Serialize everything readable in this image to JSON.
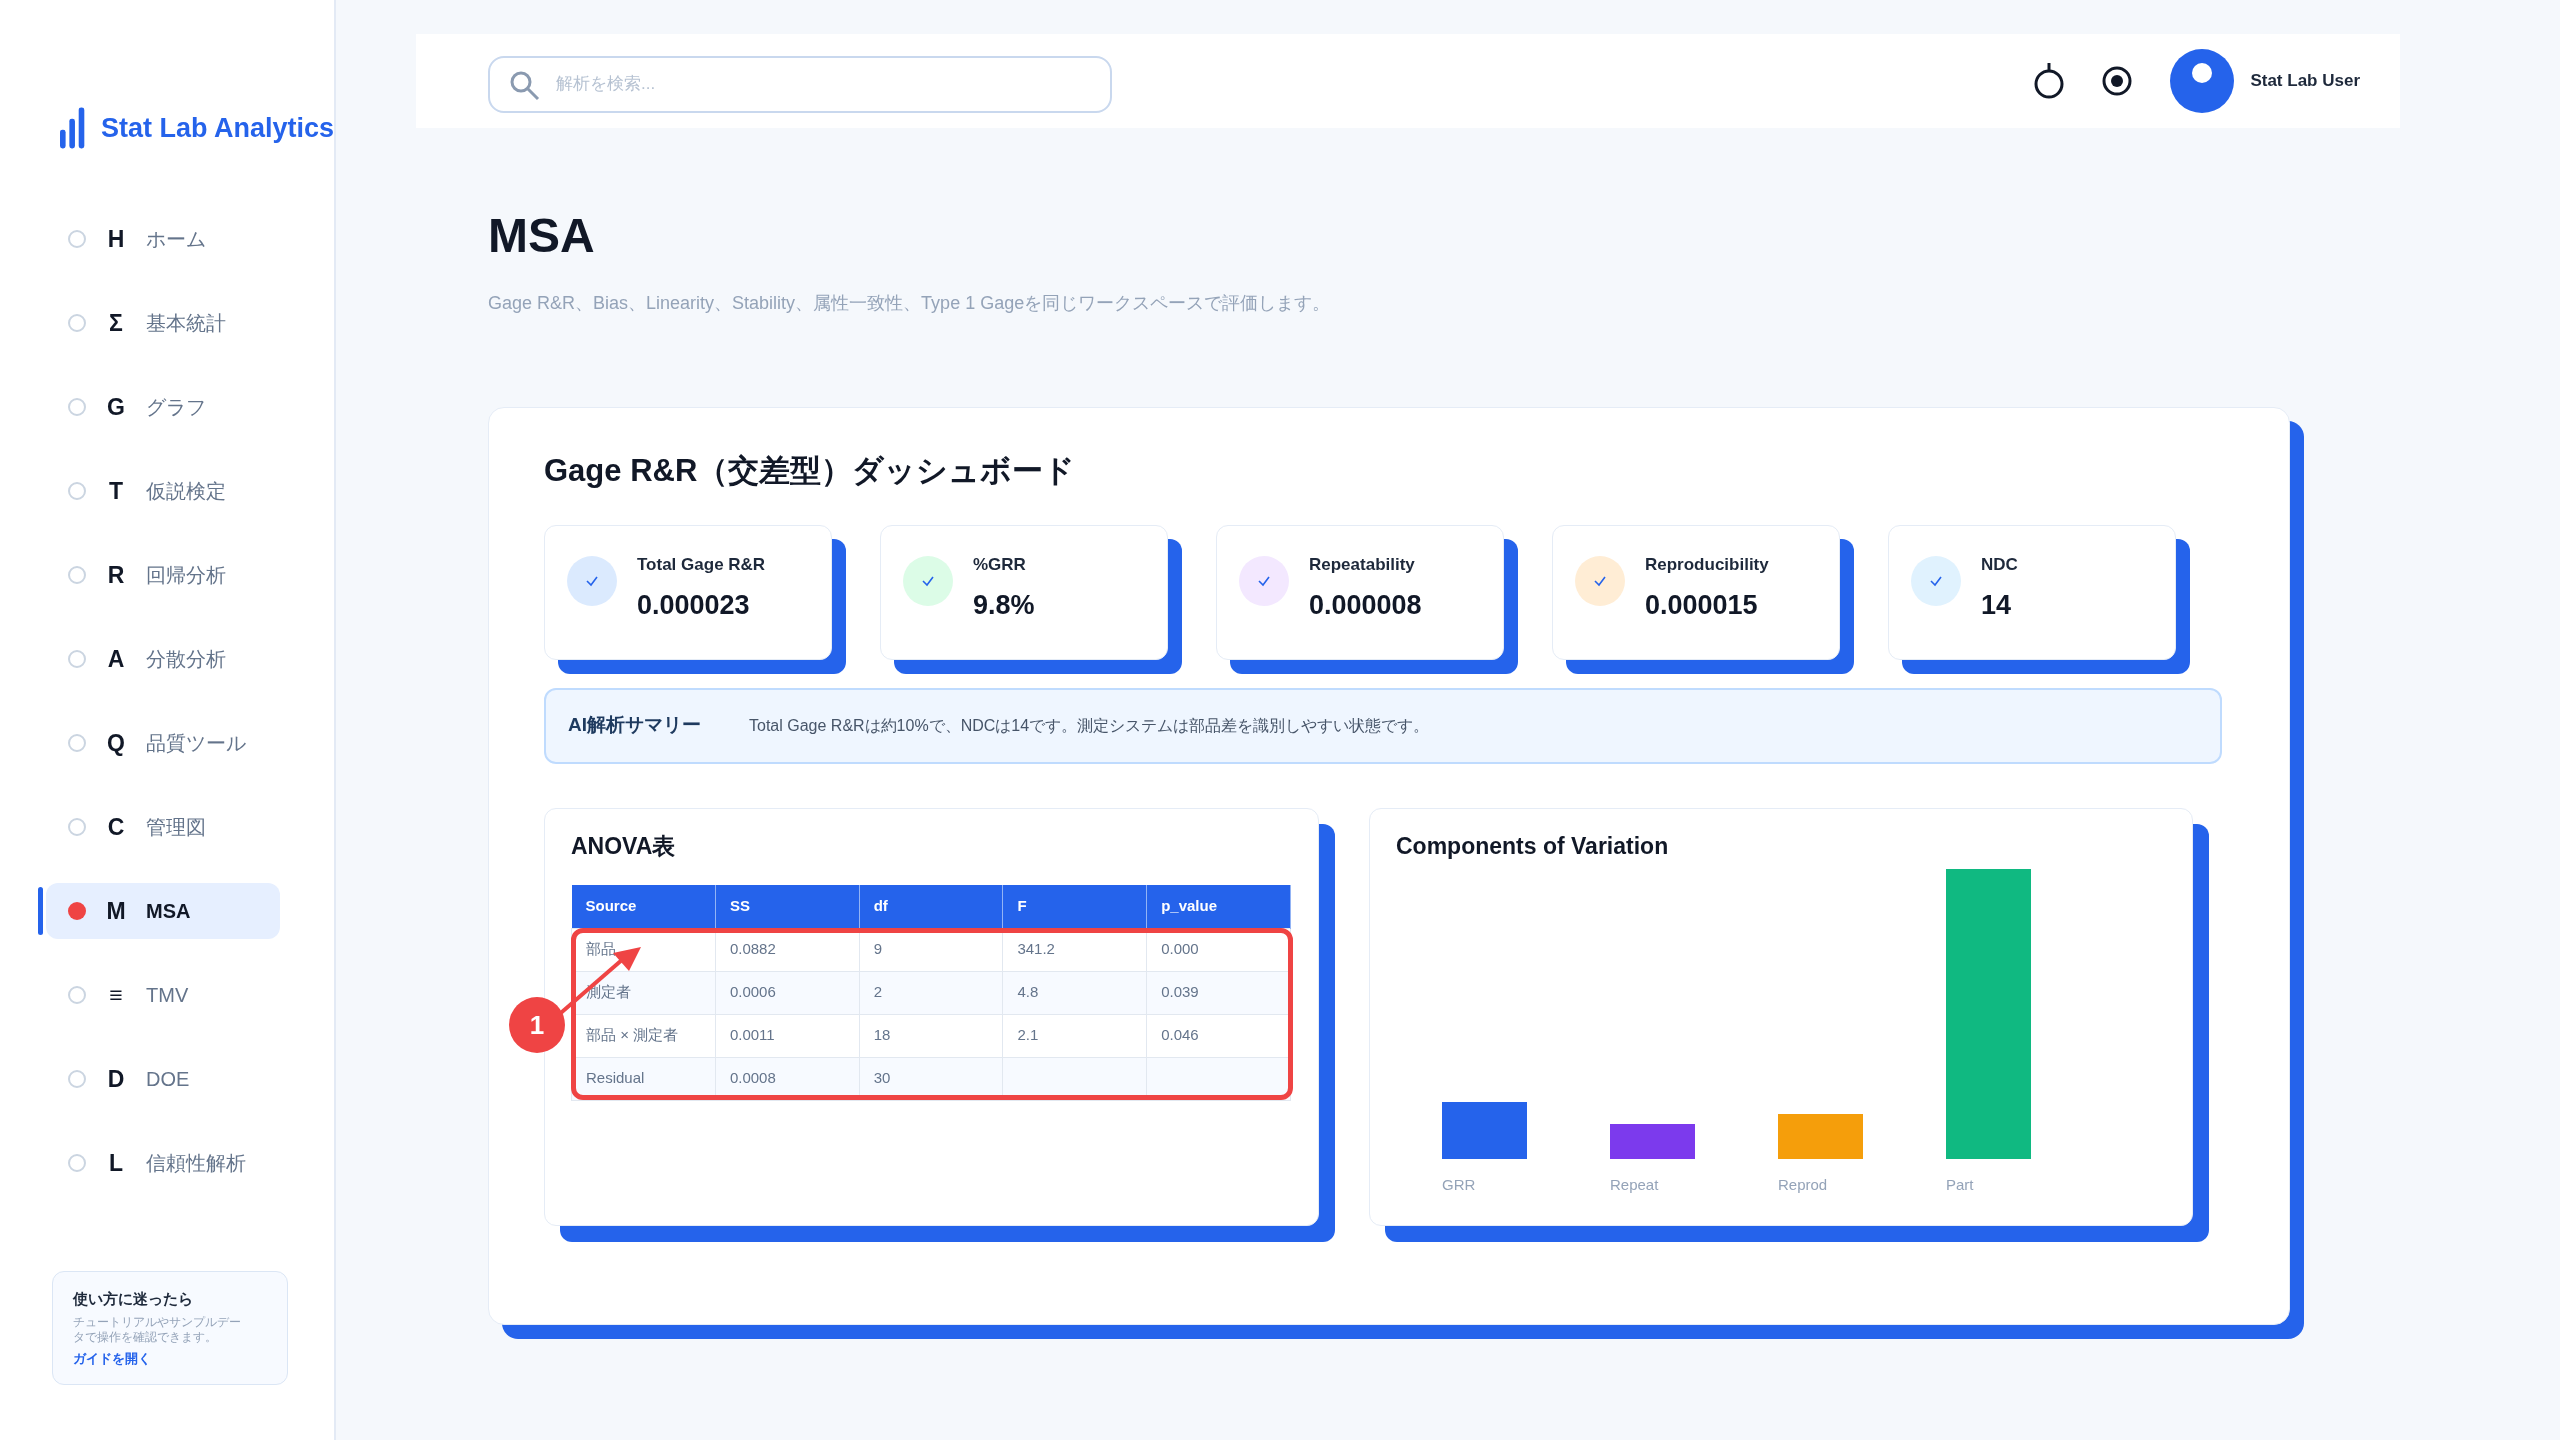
{
  "sidebar": {
    "logo": "Stat Lab Analytics",
    "items": [
      {
        "icon": "H",
        "label": "ホーム",
        "selected": false
      },
      {
        "icon": "Σ",
        "label": "基本統計",
        "selected": false
      },
      {
        "icon": "G",
        "label": "グラフ",
        "selected": false
      },
      {
        "icon": "T",
        "label": "仮説検定",
        "selected": false
      },
      {
        "icon": "R",
        "label": "回帰分析",
        "selected": false
      },
      {
        "icon": "A",
        "label": "分散分析",
        "selected": false
      },
      {
        "icon": "Q",
        "label": "品質ツール",
        "selected": false
      },
      {
        "icon": "C",
        "label": "管理図",
        "selected": false
      },
      {
        "icon": "M",
        "label": "MSA",
        "selected": true
      },
      {
        "icon": "≡",
        "label": "TMV",
        "selected": false
      },
      {
        "icon": "D",
        "label": "DOE",
        "selected": false
      },
      {
        "icon": "L",
        "label": "信頼性解析",
        "selected": false
      }
    ],
    "help": {
      "title": "使い方に迷ったら",
      "text": "チュートリアルやサンプルデータで操作を確認できます。",
      "link": "ガイドを開く"
    }
  },
  "header": {
    "search": {
      "placeholder": "解析を検索..."
    },
    "user": "Stat Lab User"
  },
  "page": {
    "title": "MSA",
    "subtitle": "Gage R&R、Bias、Linearity、Stability、属性一致性、Type 1 Gageを同じワークスペースで評価します。"
  },
  "dashboard": {
    "title": "Gage R&R（交差型）ダッシュボード",
    "kpis": [
      {
        "label": "Total Gage R&R",
        "value": "0.000023",
        "color": "#dbeafe"
      },
      {
        "label": "%GRR",
        "value": "9.8%",
        "color": "#dcfce7"
      },
      {
        "label": "Repeatability",
        "value": "0.000008",
        "color": "#f3e8ff"
      },
      {
        "label": "Reproducibility",
        "value": "0.000015",
        "color": "#ffedd5"
      },
      {
        "label": "NDC",
        "value": "14",
        "color": "#e0f2fe"
      }
    ],
    "summary": {
      "label": "AI解析サマリー",
      "text": "Total Gage R&Rは約10%で、NDCは14です。測定システムは部品差を識別しやすい状態です。"
    },
    "anova": {
      "title": "ANOVA表",
      "columns": [
        "Source",
        "SS",
        "df",
        "F",
        "p_value"
      ],
      "rows": [
        [
          "部品",
          "0.0882",
          "9",
          "341.2",
          "0.000"
        ],
        [
          "測定者",
          "0.0006",
          "2",
          "4.8",
          "0.039"
        ],
        [
          "部品 × 測定者",
          "0.0011",
          "18",
          "2.1",
          "0.046"
        ],
        [
          "Residual",
          "0.0008",
          "30",
          "",
          ""
        ]
      ],
      "annotation": {
        "label": "1"
      }
    },
    "variation": {
      "title": "Components of Variation",
      "bars": [
        {
          "label": "GRR",
          "color": "#2563eb"
        },
        {
          "label": "Repeat",
          "color": "#7c3aed"
        },
        {
          "label": "Reprod",
          "color": "#f59e0b"
        },
        {
          "label": "Part",
          "color": "#10b981"
        }
      ]
    }
  }
}
